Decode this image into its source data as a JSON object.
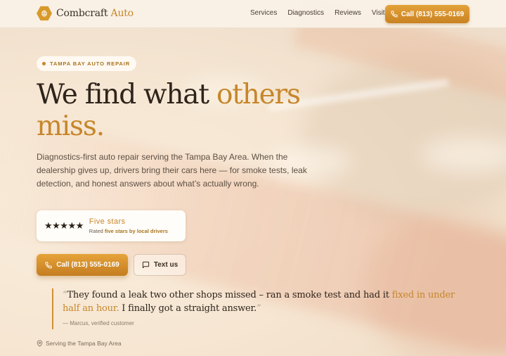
{
  "brand": {
    "name_main": "Combcraft",
    "name_accent": "Auto",
    "colors": {
      "accent": "#c6862a",
      "cta": "#d89a2c",
      "text": "#2e241b"
    }
  },
  "nav": {
    "links": [
      "Services",
      "Diagnostics",
      "Reviews",
      "Visit"
    ],
    "cta_label": "Call  (813) 555-0169"
  },
  "hero": {
    "badge": "TAMPA BAY AUTO REPAIR",
    "headline_part1": "We find what ",
    "headline_accent": "others miss",
    "headline_period": ".",
    "lede": "Diagnostics-first auto repair serving the Tampa Bay Area. When the dealership gives up, drivers bring their cars here — for smoke tests, leak detection, and honest answers about what’s actually wrong.",
    "rating": {
      "stars": "★★★★★",
      "title": "Five stars",
      "sub_prefix": "Rated ",
      "sub_bold": "five stars by local drivers"
    },
    "buttons": {
      "call": "Call (813) 555-0169",
      "text": "Text us"
    },
    "quote": {
      "open_mark": "“",
      "text_part1": "They found a leak two other shops missed – ran a smoke test and had it ",
      "text_accent": "fixed in under half an hour.",
      "text_part2": " I finally got a straight answer.",
      "close_mark": "”",
      "cite": "— Marcus, verified customer"
    },
    "location": "Serving the Tampa Bay Area"
  },
  "icons": {
    "logo": "hexagon-logo-icon",
    "phone": "phone-icon",
    "message": "message-icon",
    "pin": "map-pin-icon"
  }
}
